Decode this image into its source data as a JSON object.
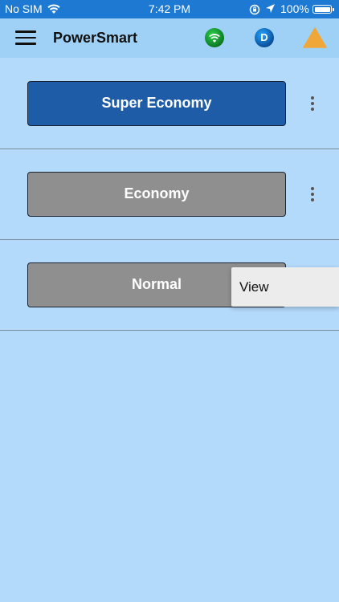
{
  "status_bar": {
    "carrier": "No SIM",
    "time": "7:42 PM",
    "battery_percent": "100%",
    "battery_level": 1.0,
    "icons": [
      "wifi-icon",
      "orientation-lock-icon",
      "location-icon",
      "battery-icon"
    ]
  },
  "app_bar": {
    "title": "PowerSmart",
    "icons": [
      "menu-icon",
      "wifi-status-icon",
      "d-badge-icon",
      "warning-icon"
    ],
    "d_badge_letter": "D",
    "colors": {
      "wifi_badge": "#1aa83a",
      "d_badge": "#0b5fb5",
      "warning": "#f0a73a"
    }
  },
  "modes": [
    {
      "label": "Super Economy",
      "state": "active",
      "color": "#1f5ca8"
    },
    {
      "label": "Economy",
      "state": "inactive",
      "color": "#8f8f8f"
    },
    {
      "label": "Normal",
      "state": "inactive",
      "color": "#8f8f8f"
    }
  ],
  "popup_menu": {
    "items": [
      {
        "label": "View"
      }
    ]
  },
  "colors": {
    "background": "#b3d9fb",
    "status_bar": "#1e79d2",
    "app_bar": "#9fd0f5"
  }
}
